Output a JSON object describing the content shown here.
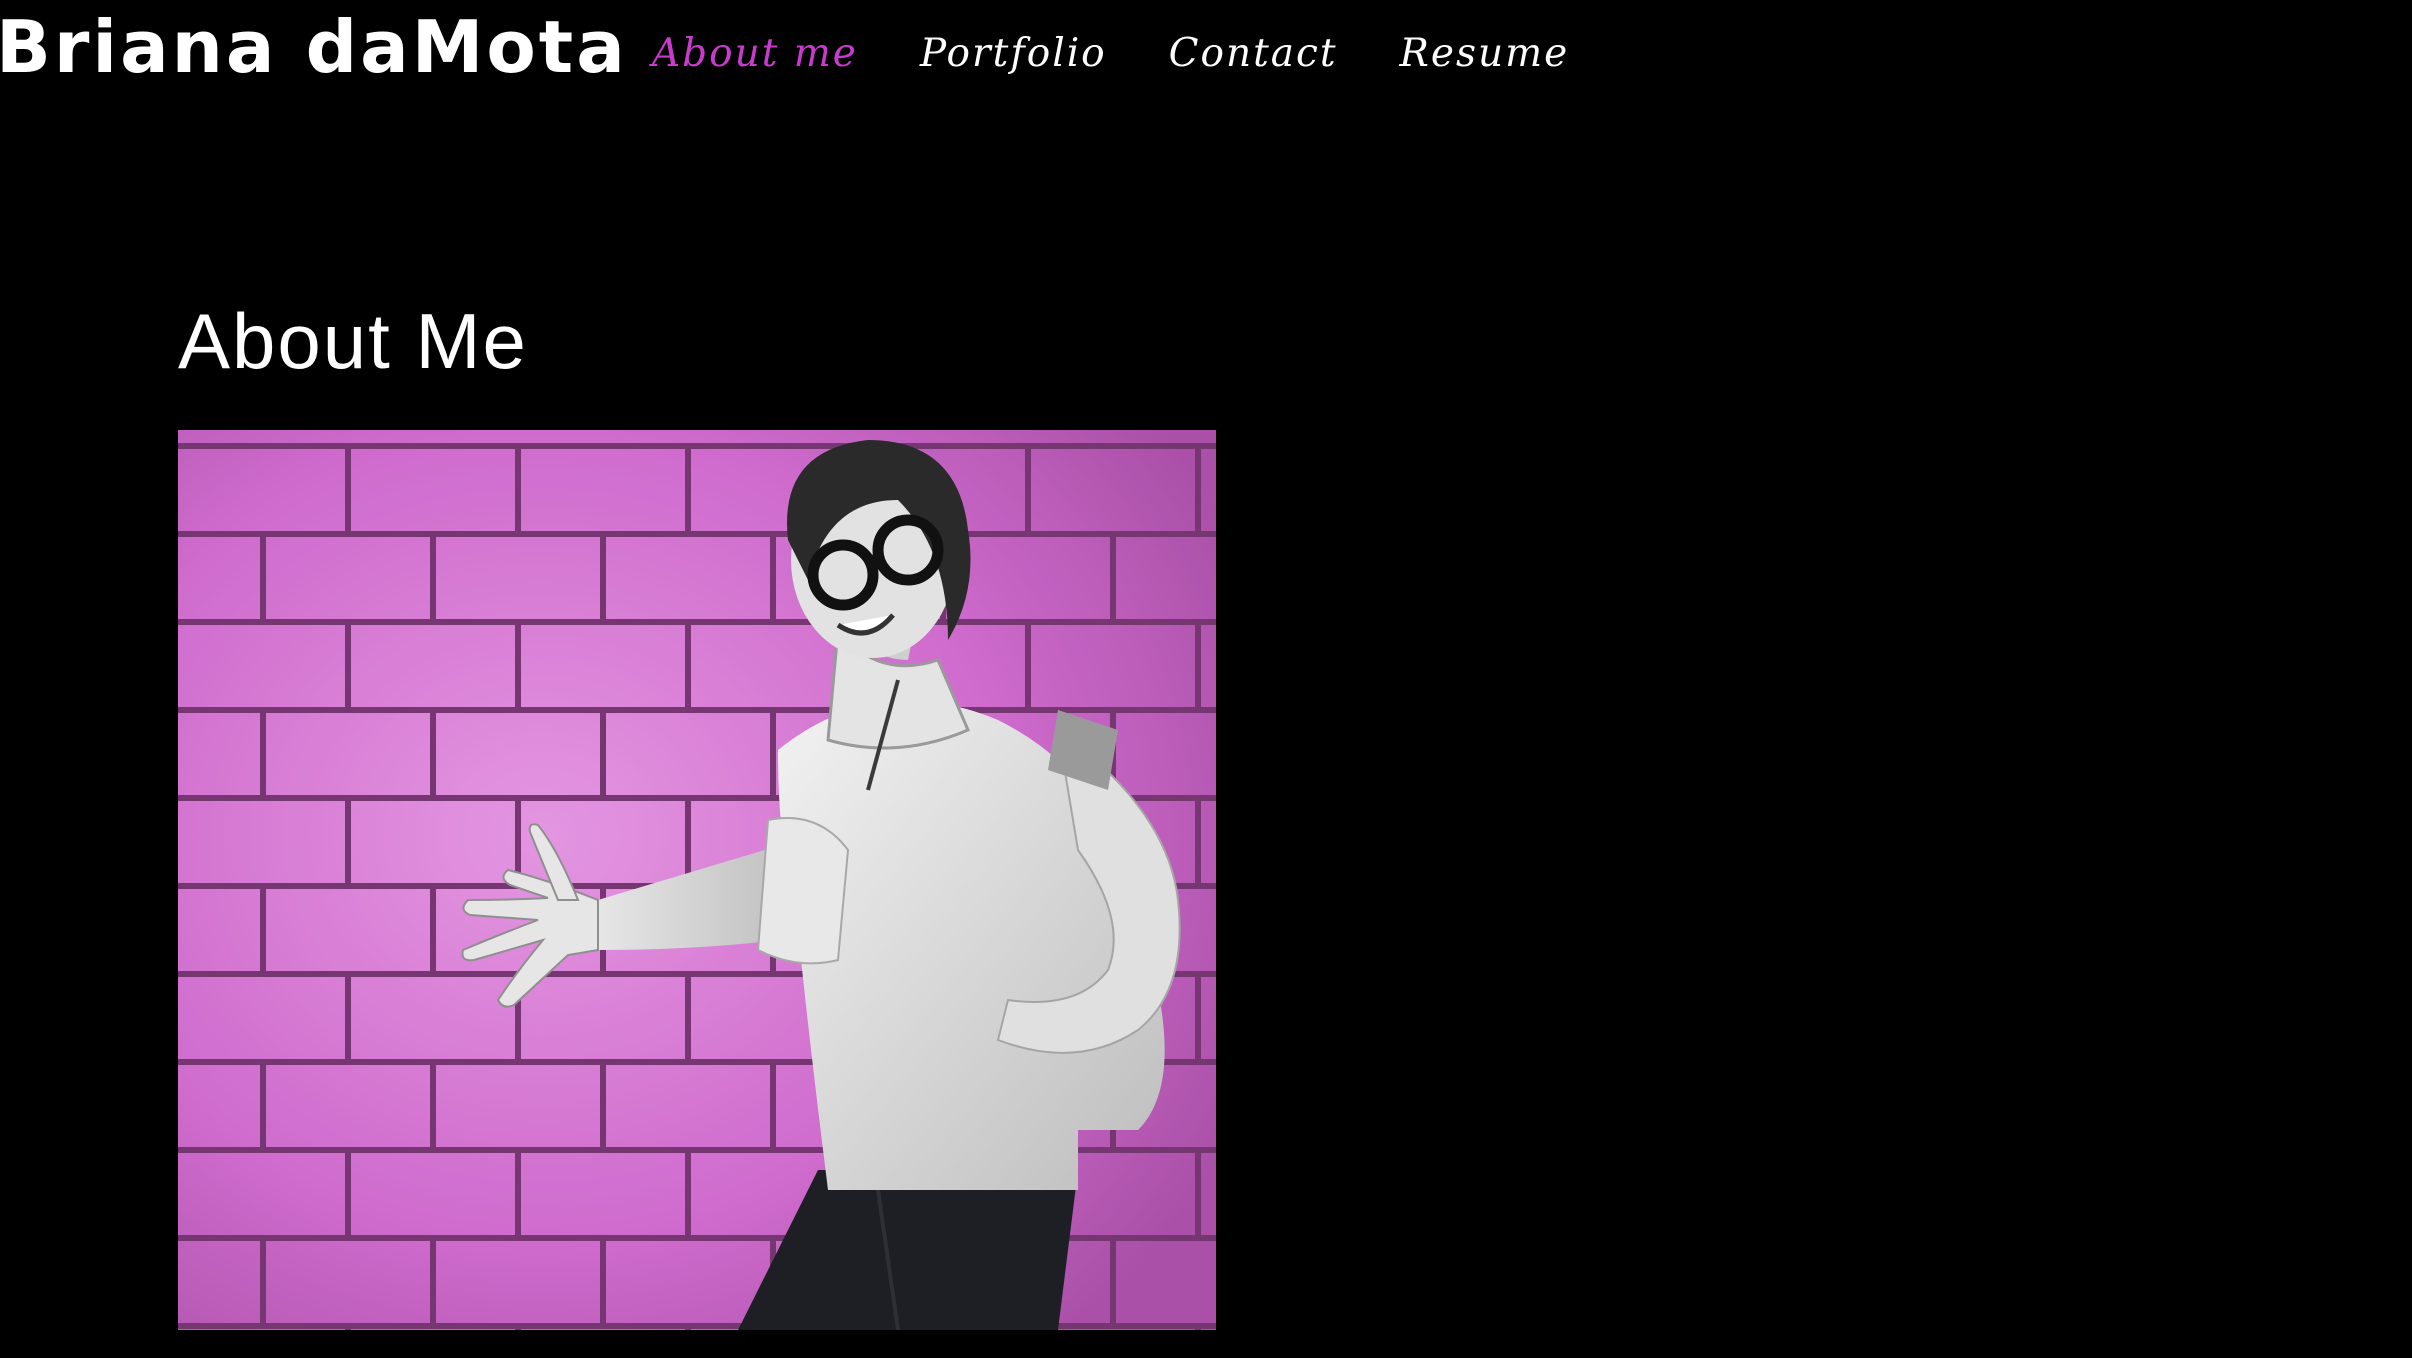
{
  "site": {
    "title": "Briana daMota"
  },
  "nav": {
    "items": [
      {
        "label": "About me",
        "active": true
      },
      {
        "label": "Portfolio",
        "active": false
      },
      {
        "label": "Contact",
        "active": false
      },
      {
        "label": "Resume",
        "active": false
      }
    ]
  },
  "about": {
    "heading": "About Me",
    "photo": {
      "alt": "Photo of Briana daMota leaning against a pink brick wall"
    }
  },
  "colors": {
    "background": "#000000",
    "text": "#ffffff",
    "accent": "#c93bcc",
    "brick": "#e27de0",
    "mortar": "#7d3a7a"
  }
}
